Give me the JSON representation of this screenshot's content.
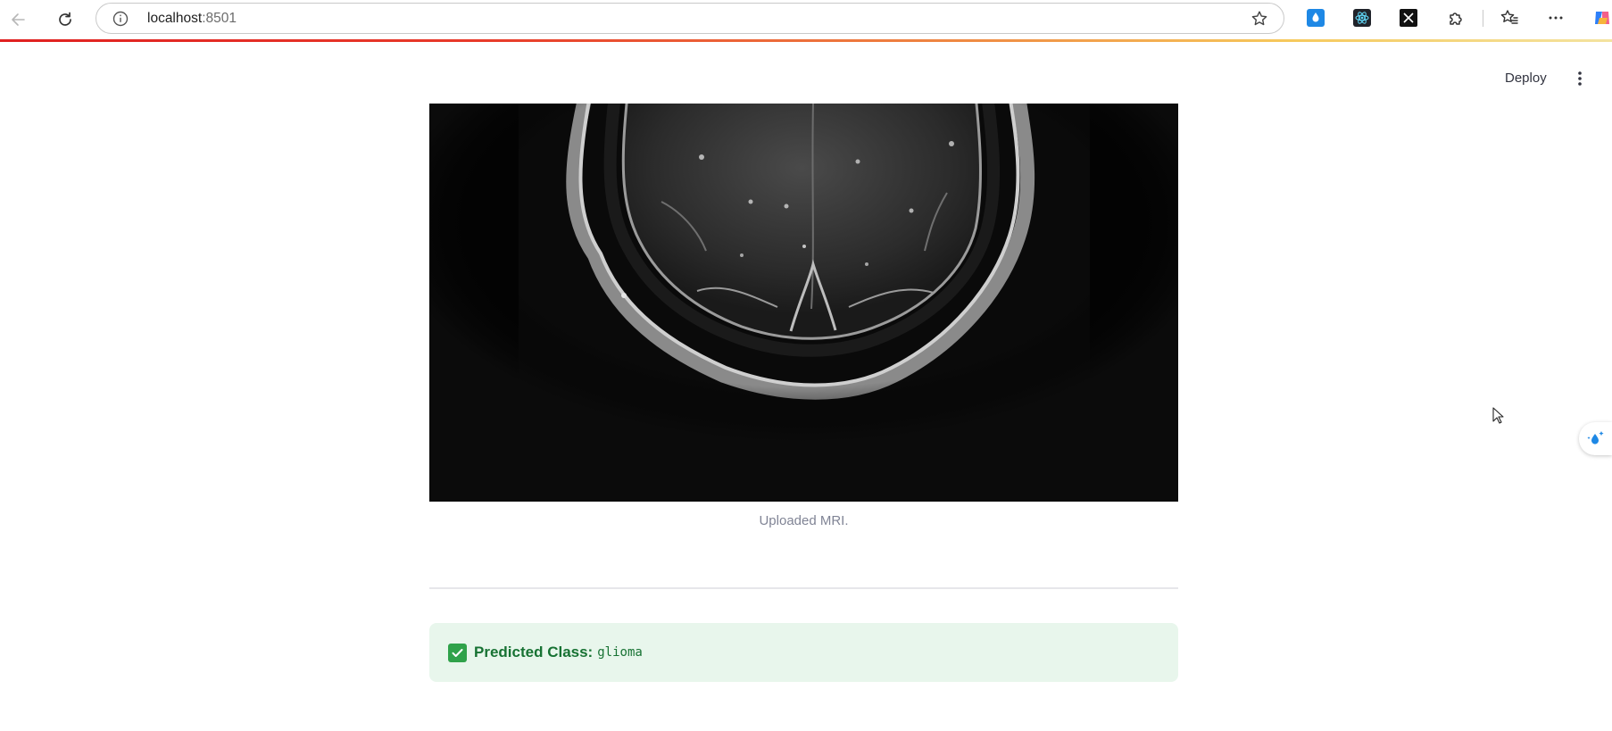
{
  "browser": {
    "url_host": "localhost",
    "url_port": ":8501",
    "extensions": [
      "water-drop-icon",
      "react-atom-icon",
      "x-logo-icon",
      "puzzle-icon"
    ]
  },
  "header": {
    "deploy_label": "Deploy"
  },
  "main": {
    "image_caption": "Uploaded MRI.",
    "alert": {
      "label": "Predicted Class:",
      "value": "glioma",
      "status": "success"
    }
  },
  "colors": {
    "alert_bg": "#e8f6ec",
    "alert_text": "#177233",
    "alert_icon": "#2fa24a",
    "caption_text": "#808495"
  }
}
